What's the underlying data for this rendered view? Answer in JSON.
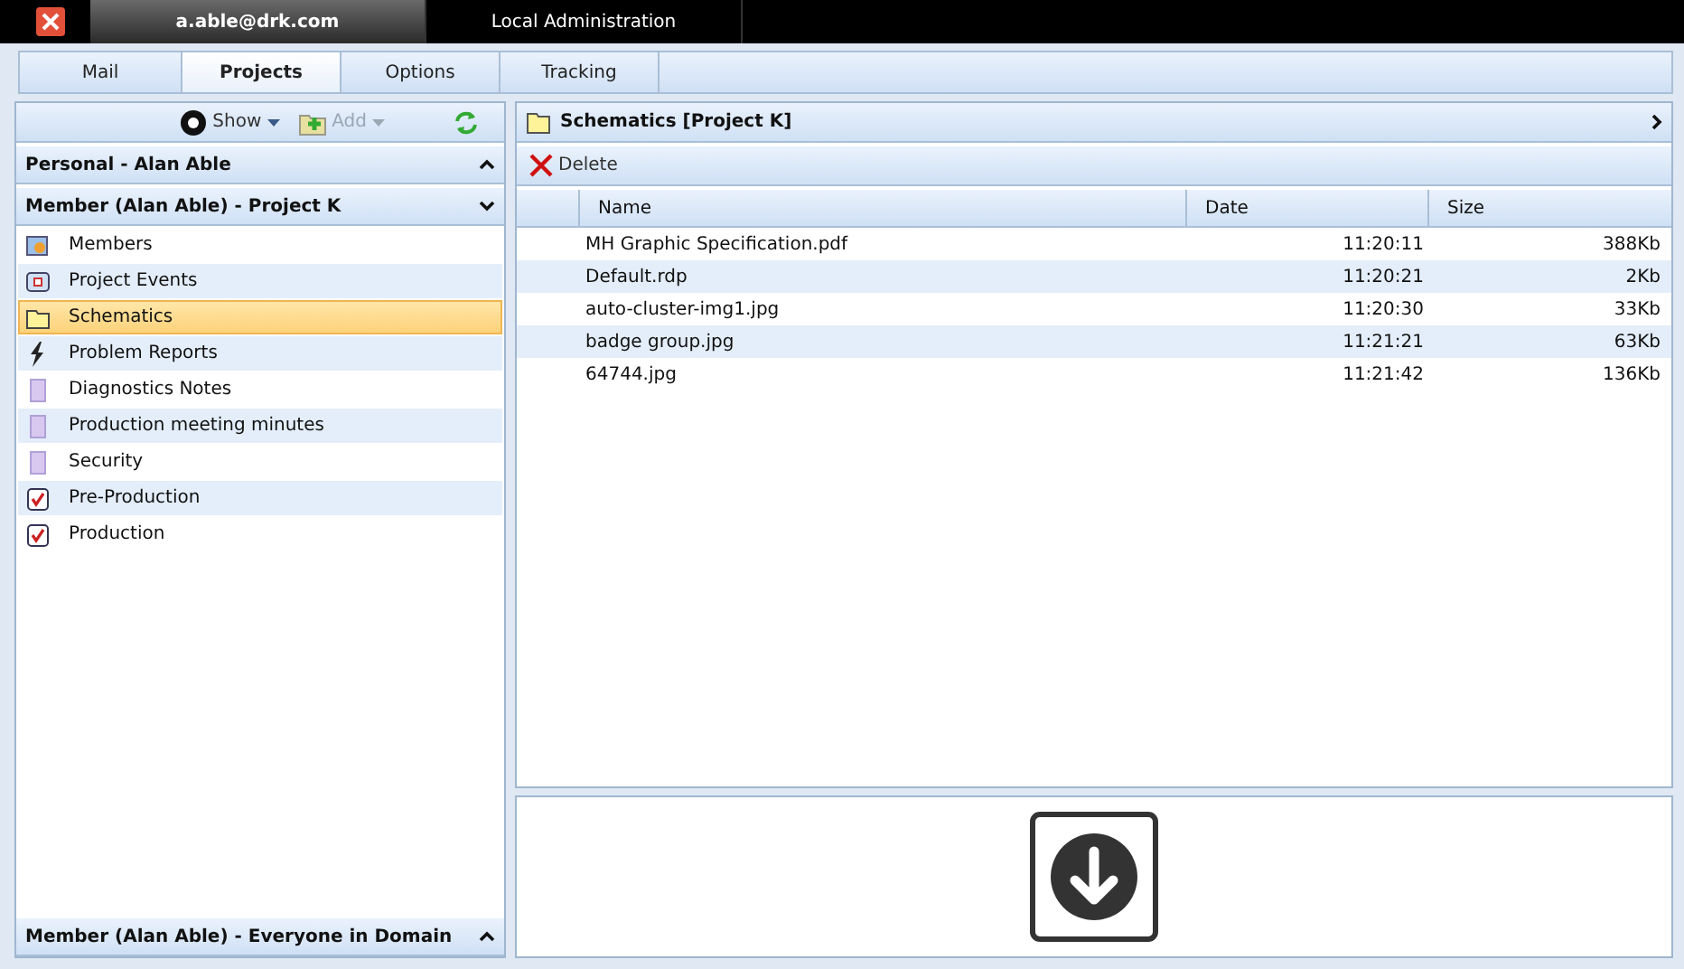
{
  "top_tabs": [
    {
      "label": "a.able@drk.com",
      "selected": true
    },
    {
      "label": "Local Administration",
      "selected": false
    }
  ],
  "tabs": [
    {
      "label": "Mail",
      "selected": false
    },
    {
      "label": "Projects",
      "selected": true
    },
    {
      "label": "Options",
      "selected": false
    },
    {
      "label": "Tracking",
      "selected": false
    }
  ],
  "toolbar": {
    "show": {
      "label": "Show",
      "disabled": false
    },
    "add": {
      "label": "Add",
      "disabled": true
    }
  },
  "sections": [
    {
      "title": "Personal - Alan Able",
      "expanded": false
    },
    {
      "title": "Member (Alan Able) - Project K",
      "expanded": true,
      "items": [
        {
          "label": "Members",
          "kind": "members",
          "selected": false
        },
        {
          "label": "Project Events",
          "kind": "events",
          "selected": false
        },
        {
          "label": "Schematics",
          "kind": "folder",
          "selected": true
        },
        {
          "label": "Problem Reports",
          "kind": "bolt",
          "selected": false
        },
        {
          "label": "Diagnostics Notes",
          "kind": "note",
          "selected": false
        },
        {
          "label": "Production meeting minutes",
          "kind": "note",
          "selected": false
        },
        {
          "label": "Security",
          "kind": "note",
          "selected": false
        },
        {
          "label": "Pre-Production",
          "kind": "task",
          "selected": false
        },
        {
          "label": "Production",
          "kind": "task",
          "selected": false
        }
      ]
    }
  ],
  "bottom_section": {
    "title": "Member (Alan Able) - Everyone in Domain",
    "expanded": false
  },
  "folder": {
    "title": "Schematics [Project K]",
    "actions": [
      "Delete"
    ]
  },
  "table": {
    "columns": [
      "Name",
      "Date",
      "Size"
    ],
    "rows": [
      [
        "MH Graphic Specification.pdf",
        "11:20:11",
        "388Kb"
      ],
      [
        "Default.rdp",
        "11:20:21",
        "2Kb"
      ],
      [
        "auto-cluster-img1.jpg",
        "11:20:30",
        "33Kb"
      ],
      [
        "badge group.jpg",
        "11:21:21",
        "63Kb"
      ],
      [
        "64744.jpg",
        "11:21:42",
        "136Kb"
      ]
    ]
  }
}
